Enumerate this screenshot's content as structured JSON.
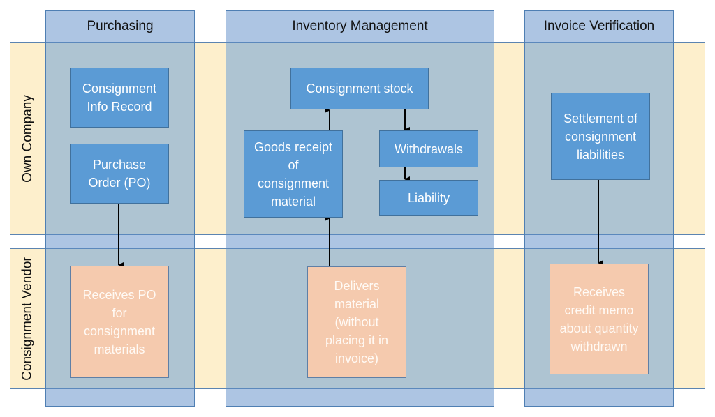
{
  "columns": [
    {
      "id": "purchasing",
      "label": "Purchasing"
    },
    {
      "id": "inventory",
      "label": "Inventory Management"
    },
    {
      "id": "invoice",
      "label": "Invoice Verification"
    }
  ],
  "rows": [
    {
      "id": "own",
      "label": "Own Company"
    },
    {
      "id": "vendor",
      "label": "Consignment Vendor"
    }
  ],
  "boxes": {
    "info_record": "Consignment Info Record",
    "purchase_order": "Purchase Order (PO)",
    "receives_po": "Receives PO for consignment materials",
    "consignment_stock": "Consignment stock",
    "goods_receipt": "Goods receipt of consignment material",
    "withdrawals": "Withdrawals",
    "liability": "Liability",
    "delivers_material": "Delivers material (without placing it in invoice)",
    "settlement": "Settlement of consignment liabilities",
    "credit_memo": "Receives credit memo about quantity withdrawn"
  },
  "edges": [
    {
      "from": "purchase_order",
      "to": "receives_po"
    },
    {
      "from": "delivers_material",
      "to": "goods_receipt"
    },
    {
      "from": "goods_receipt",
      "to": "consignment_stock"
    },
    {
      "from": "consignment_stock",
      "to": "withdrawals"
    },
    {
      "from": "withdrawals",
      "to": "liability"
    },
    {
      "from": "settlement",
      "to": "credit_memo"
    }
  ],
  "colors": {
    "process_box": "#5b9bd5",
    "vendor_box": "#f5caae",
    "row_band": "#fdefcc",
    "column_header": "#a9c8e6"
  }
}
